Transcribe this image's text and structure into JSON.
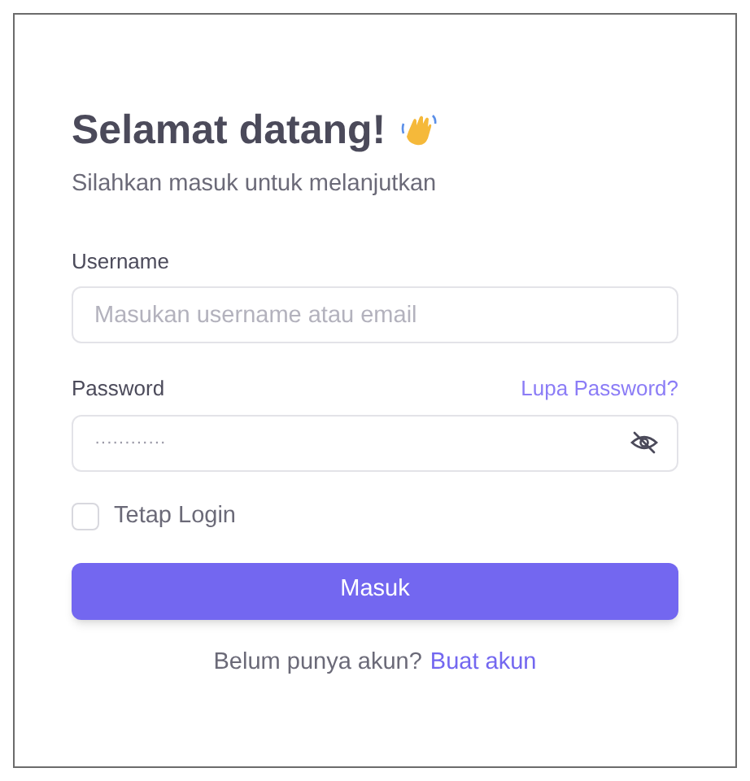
{
  "title": "Selamat datang!",
  "subtitle": "Silahkan masuk untuk melanjutkan",
  "username": {
    "label": "Username",
    "placeholder": "Masukan username atau email"
  },
  "password": {
    "label": "Password",
    "forgot_link": "Lupa Password?",
    "placeholder": "············",
    "visible": false
  },
  "remember": {
    "label": "Tetap Login",
    "checked": false
  },
  "submit": "Masuk",
  "footer": {
    "text": "Belum punya akun?",
    "link": "Buat akun"
  }
}
